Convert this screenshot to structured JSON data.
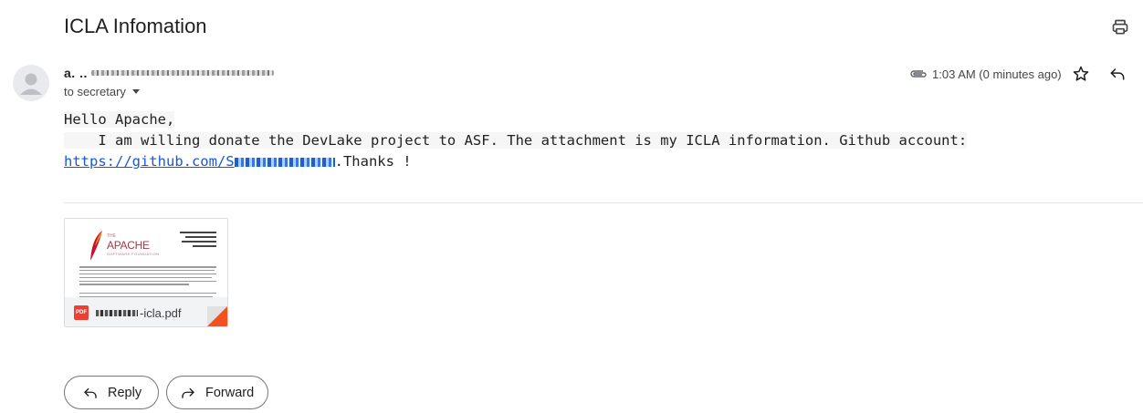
{
  "email": {
    "subject": "ICLA Infomation",
    "sender_visible": "a. ..",
    "to_line": "to secretary",
    "time": "1:03 AM (0 minutes ago)",
    "body": {
      "line1": "Hello Apache,",
      "line2": "    I am willing donate the DevLake project to ASF. The attachment is my ICLA information. Github account:",
      "link_prefix": "https://github.com/S",
      "line3_suffix": ".Thanks !"
    },
    "attachment": {
      "logo_text": "APACHE",
      "file_type_badge": "PDF",
      "filename_visible": "-icla.pdf"
    },
    "actions": {
      "reply_label": "Reply",
      "forward_label": "Forward"
    }
  },
  "icons": {
    "print": "print-icon",
    "avatar": "person-icon",
    "attachment": "paperclip-icon",
    "star": "star-icon",
    "reply": "reply-icon",
    "forward": "forward-icon"
  },
  "colors": {
    "link": "#1a57d6",
    "pdf_badge": "#e94235",
    "apache_feather": "#c8102e"
  }
}
